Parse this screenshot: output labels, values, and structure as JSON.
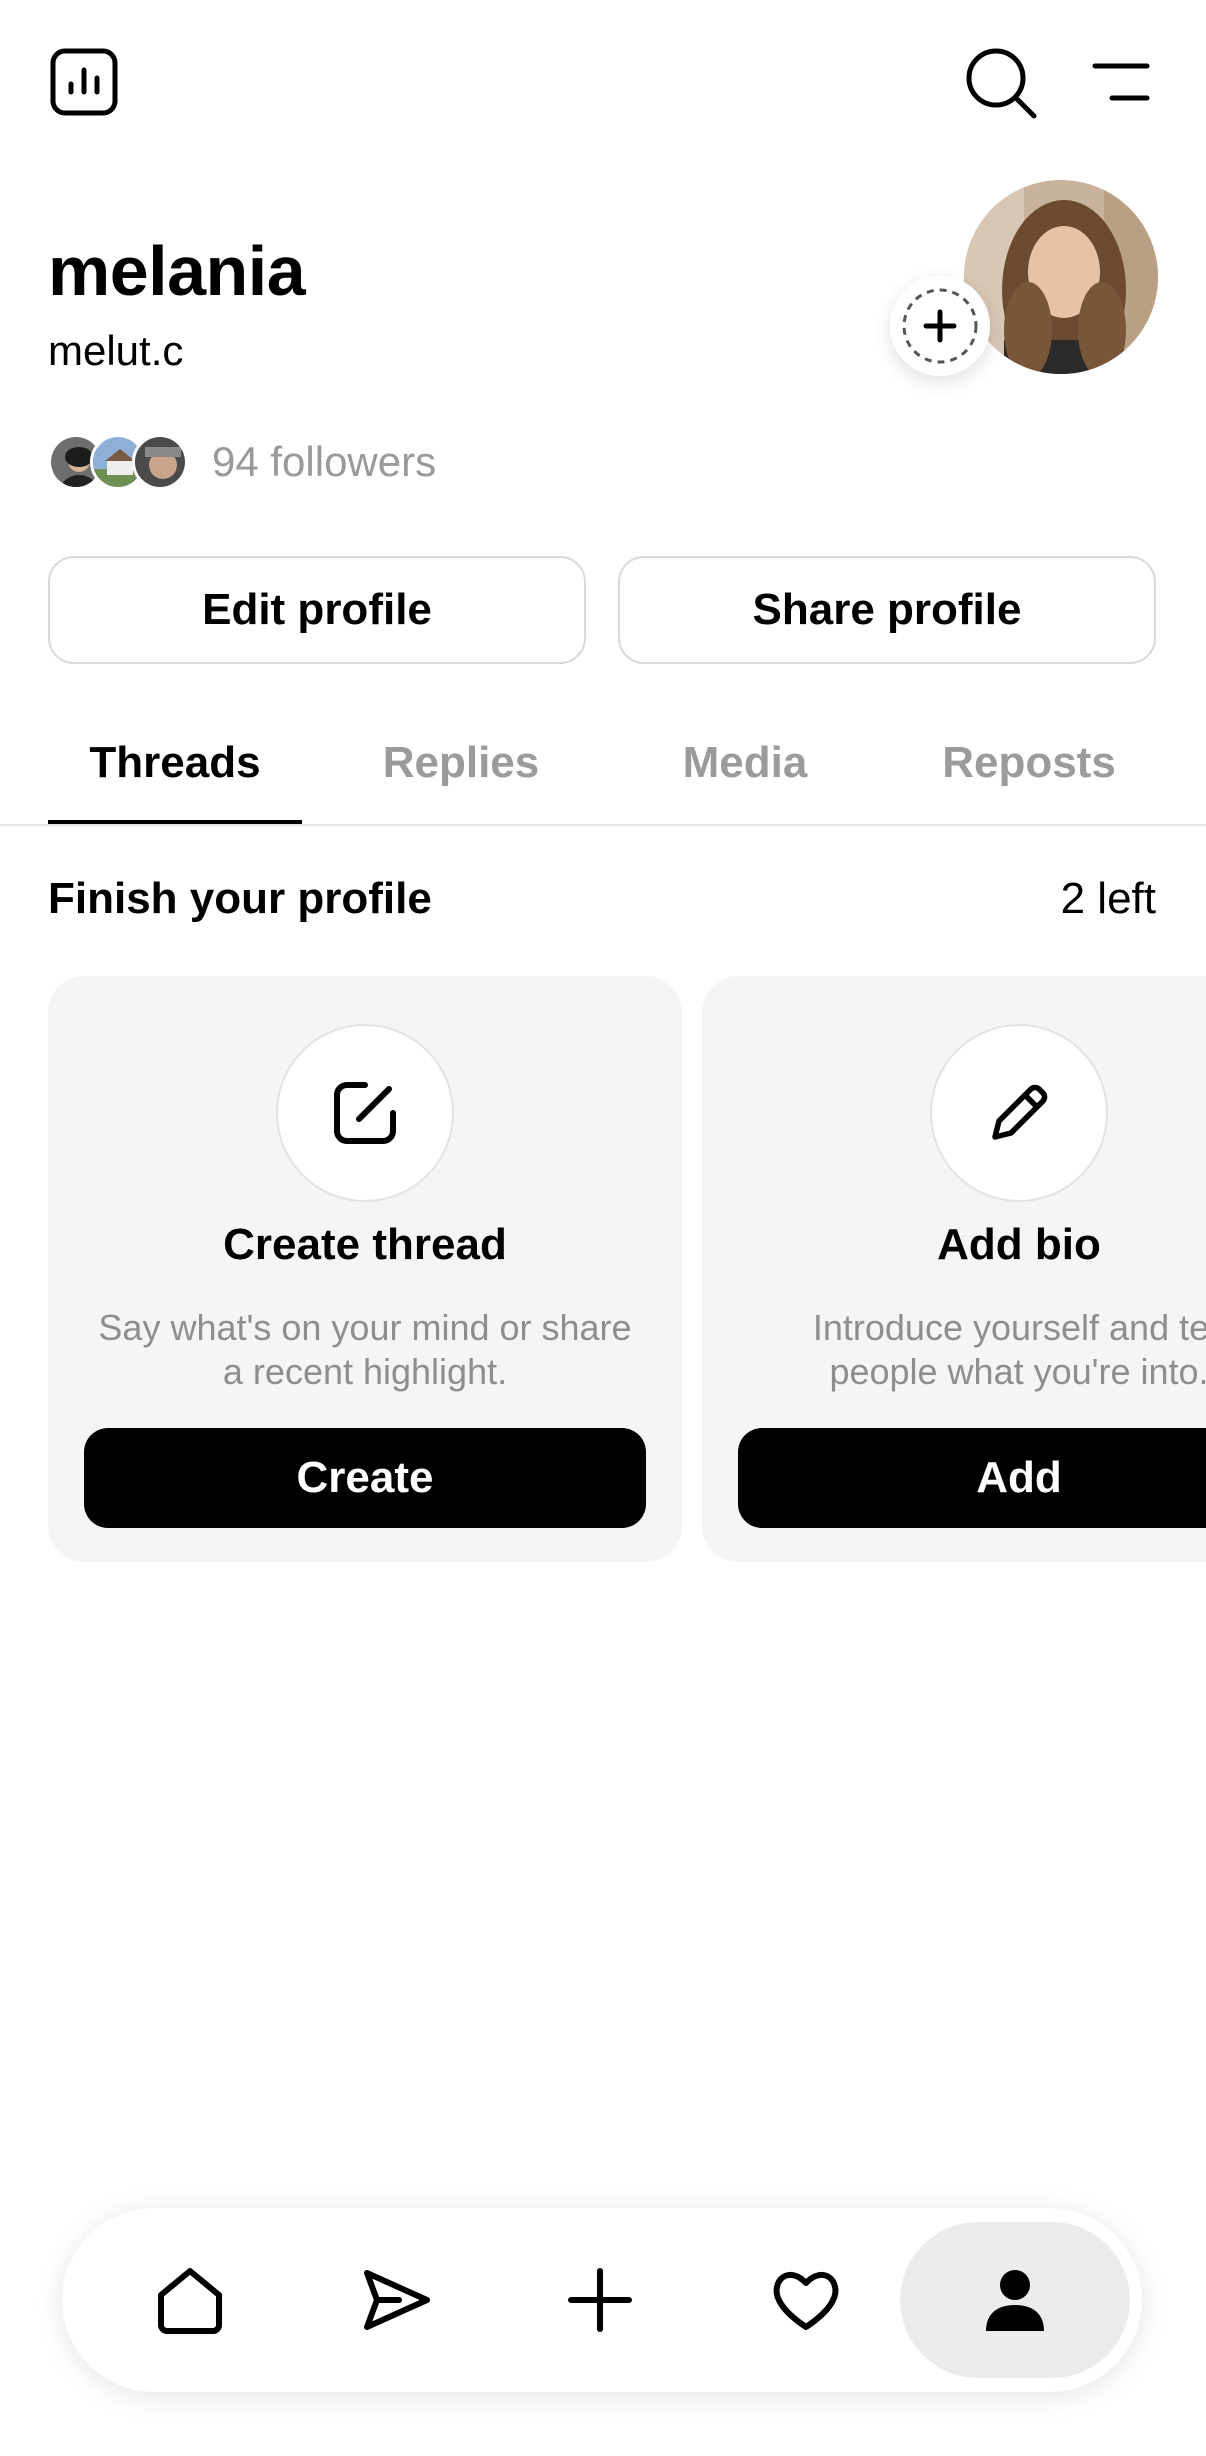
{
  "profile": {
    "display_name": "melania",
    "username": "melut.c",
    "followers_label": "94 followers"
  },
  "actions": {
    "edit_profile": "Edit profile",
    "share_profile": "Share profile"
  },
  "tabs": [
    {
      "label": "Threads",
      "active": true
    },
    {
      "label": "Replies",
      "active": false
    },
    {
      "label": "Media",
      "active": false
    },
    {
      "label": "Reposts",
      "active": false
    }
  ],
  "finish_profile": {
    "title": "Finish your profile",
    "remaining": "2 left",
    "cards": [
      {
        "icon": "edit-square-icon",
        "title": "Create thread",
        "description": "Say what's on your mind or share\na recent highlight.",
        "button": "Create"
      },
      {
        "icon": "pencil-icon",
        "title": "Add bio",
        "description": "Introduce yourself and tell\npeople what you're into.",
        "button": "Add"
      }
    ]
  },
  "top_bar": {
    "left_icon": "insights-chart-icon",
    "right_icons": [
      "search-icon",
      "menu-icon"
    ]
  },
  "bottom_nav": {
    "items": [
      "home-icon",
      "send-icon",
      "plus-icon",
      "heart-icon",
      "profile-icon"
    ],
    "active": "profile-icon"
  },
  "colors": {
    "muted_text": "#999999",
    "card_background": "#f5f5f5",
    "button_background": "#000000"
  }
}
